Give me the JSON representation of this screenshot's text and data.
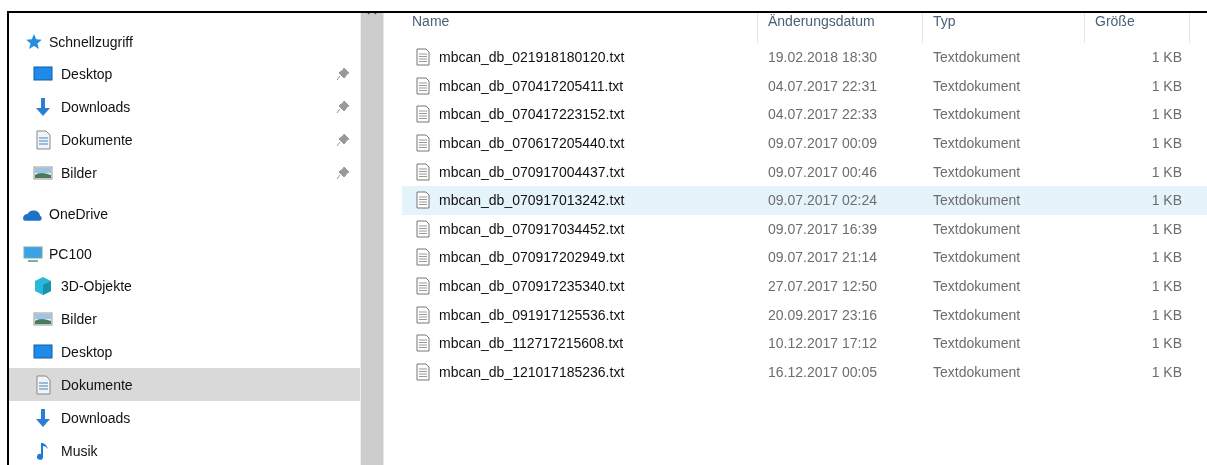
{
  "sidebar": {
    "sections": [
      {
        "label": "Schnellzugriff",
        "kind": "star",
        "items": [
          {
            "label": "Desktop",
            "kind": "desktop",
            "pinned": true,
            "selected": false
          },
          {
            "label": "Downloads",
            "kind": "download",
            "pinned": true,
            "selected": false
          },
          {
            "label": "Dokumente",
            "kind": "document",
            "pinned": true,
            "selected": false
          },
          {
            "label": "Bilder",
            "kind": "pictures",
            "pinned": true,
            "selected": false
          }
        ]
      },
      {
        "label": "OneDrive",
        "kind": "cloud"
      },
      {
        "label": "PC100",
        "kind": "pc",
        "items": [
          {
            "label": "3D-Objekte",
            "kind": "cube",
            "pinned": false,
            "selected": false
          },
          {
            "label": "Bilder",
            "kind": "pictures",
            "pinned": false,
            "selected": false
          },
          {
            "label": "Desktop",
            "kind": "desktop",
            "pinned": false,
            "selected": false
          },
          {
            "label": "Dokumente",
            "kind": "document",
            "pinned": false,
            "selected": true
          },
          {
            "label": "Downloads",
            "kind": "download",
            "pinned": false,
            "selected": false
          },
          {
            "label": "Musik",
            "kind": "music",
            "pinned": false,
            "selected": false
          }
        ]
      }
    ]
  },
  "table": {
    "columns": [
      "Name",
      "Änderungsdatum",
      "Typ",
      "Größe"
    ],
    "rows": [
      {
        "name": "mbcan_db_021918180120.txt",
        "date": "19.02.2018 18:30",
        "type": "Textdokument",
        "size": "1 KB",
        "selected": false
      },
      {
        "name": "mbcan_db_070417205411.txt",
        "date": "04.07.2017 22:31",
        "type": "Textdokument",
        "size": "1 KB",
        "selected": false
      },
      {
        "name": "mbcan_db_070417223152.txt",
        "date": "04.07.2017 22:33",
        "type": "Textdokument",
        "size": "1 KB",
        "selected": false
      },
      {
        "name": "mbcan_db_070617205440.txt",
        "date": "09.07.2017 00:09",
        "type": "Textdokument",
        "size": "1 KB",
        "selected": false
      },
      {
        "name": "mbcan_db_070917004437.txt",
        "date": "09.07.2017 00:46",
        "type": "Textdokument",
        "size": "1 KB",
        "selected": false
      },
      {
        "name": "mbcan_db_070917013242.txt",
        "date": "09.07.2017 02:24",
        "type": "Textdokument",
        "size": "1 KB",
        "selected": true
      },
      {
        "name": "mbcan_db_070917034452.txt",
        "date": "09.07.2017 16:39",
        "type": "Textdokument",
        "size": "1 KB",
        "selected": false
      },
      {
        "name": "mbcan_db_070917202949.txt",
        "date": "09.07.2017 21:14",
        "type": "Textdokument",
        "size": "1 KB",
        "selected": false
      },
      {
        "name": "mbcan_db_070917235340.txt",
        "date": "27.07.2017 12:50",
        "type": "Textdokument",
        "size": "1 KB",
        "selected": false
      },
      {
        "name": "mbcan_db_091917125536.txt",
        "date": "20.09.2017 23:16",
        "type": "Textdokument",
        "size": "1 KB",
        "selected": false
      },
      {
        "name": "mbcan_db_112717215608.txt",
        "date": "10.12.2017 17:12",
        "type": "Textdokument",
        "size": "1 KB",
        "selected": false
      },
      {
        "name": "mbcan_db_121017185236.txt",
        "date": "16.12.2017 00:05",
        "type": "Textdokument",
        "size": "1 KB",
        "selected": false
      }
    ]
  }
}
